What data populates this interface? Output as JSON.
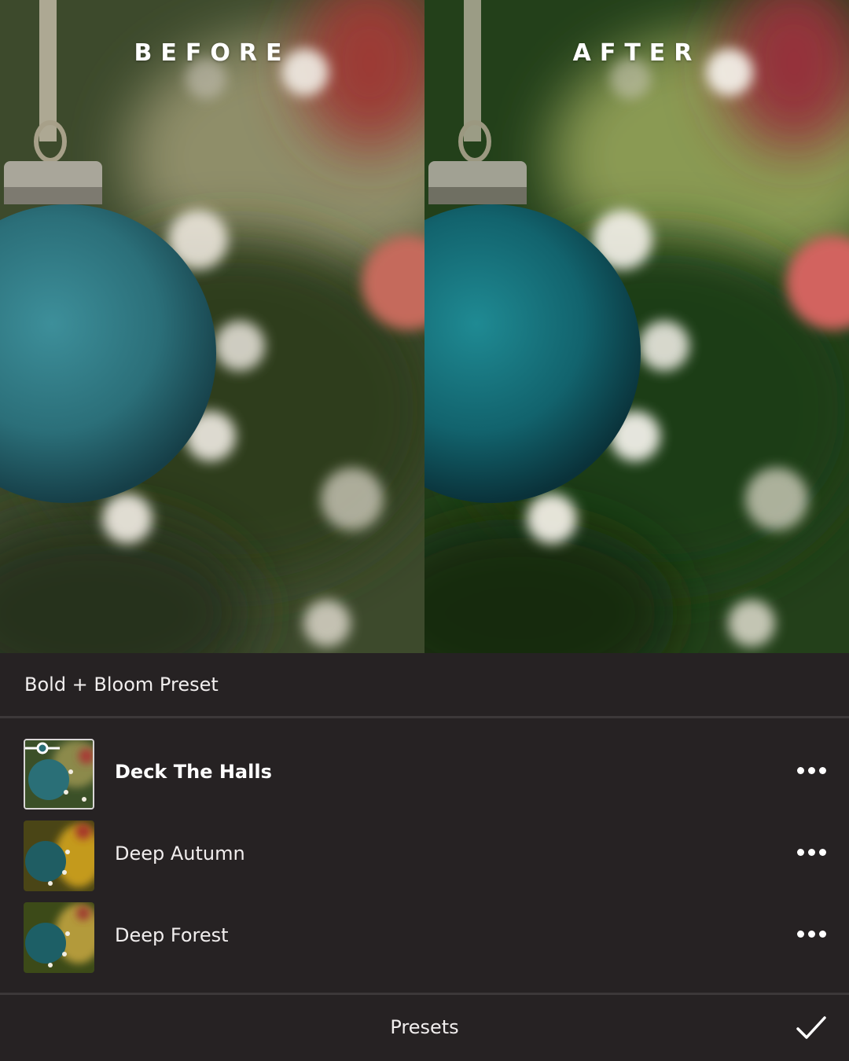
{
  "comparison": {
    "before_label": "BEFORE",
    "after_label": "AFTER"
  },
  "panel": {
    "group_title": "Bold + Bloom Preset",
    "presets": [
      {
        "label": "Deck The Halls",
        "selected": true
      },
      {
        "label": "Deep Autumn",
        "selected": false
      },
      {
        "label": "Deep Forest",
        "selected": false
      }
    ],
    "more_icon": "more-horizontal-icon",
    "footer_label": "Presets",
    "confirm_icon": "checkmark-icon"
  },
  "colors": {
    "panel_background": "#262223",
    "divider": "#3c3839",
    "text": "#f1eeee",
    "ornament_teal": "#2b7a86"
  }
}
